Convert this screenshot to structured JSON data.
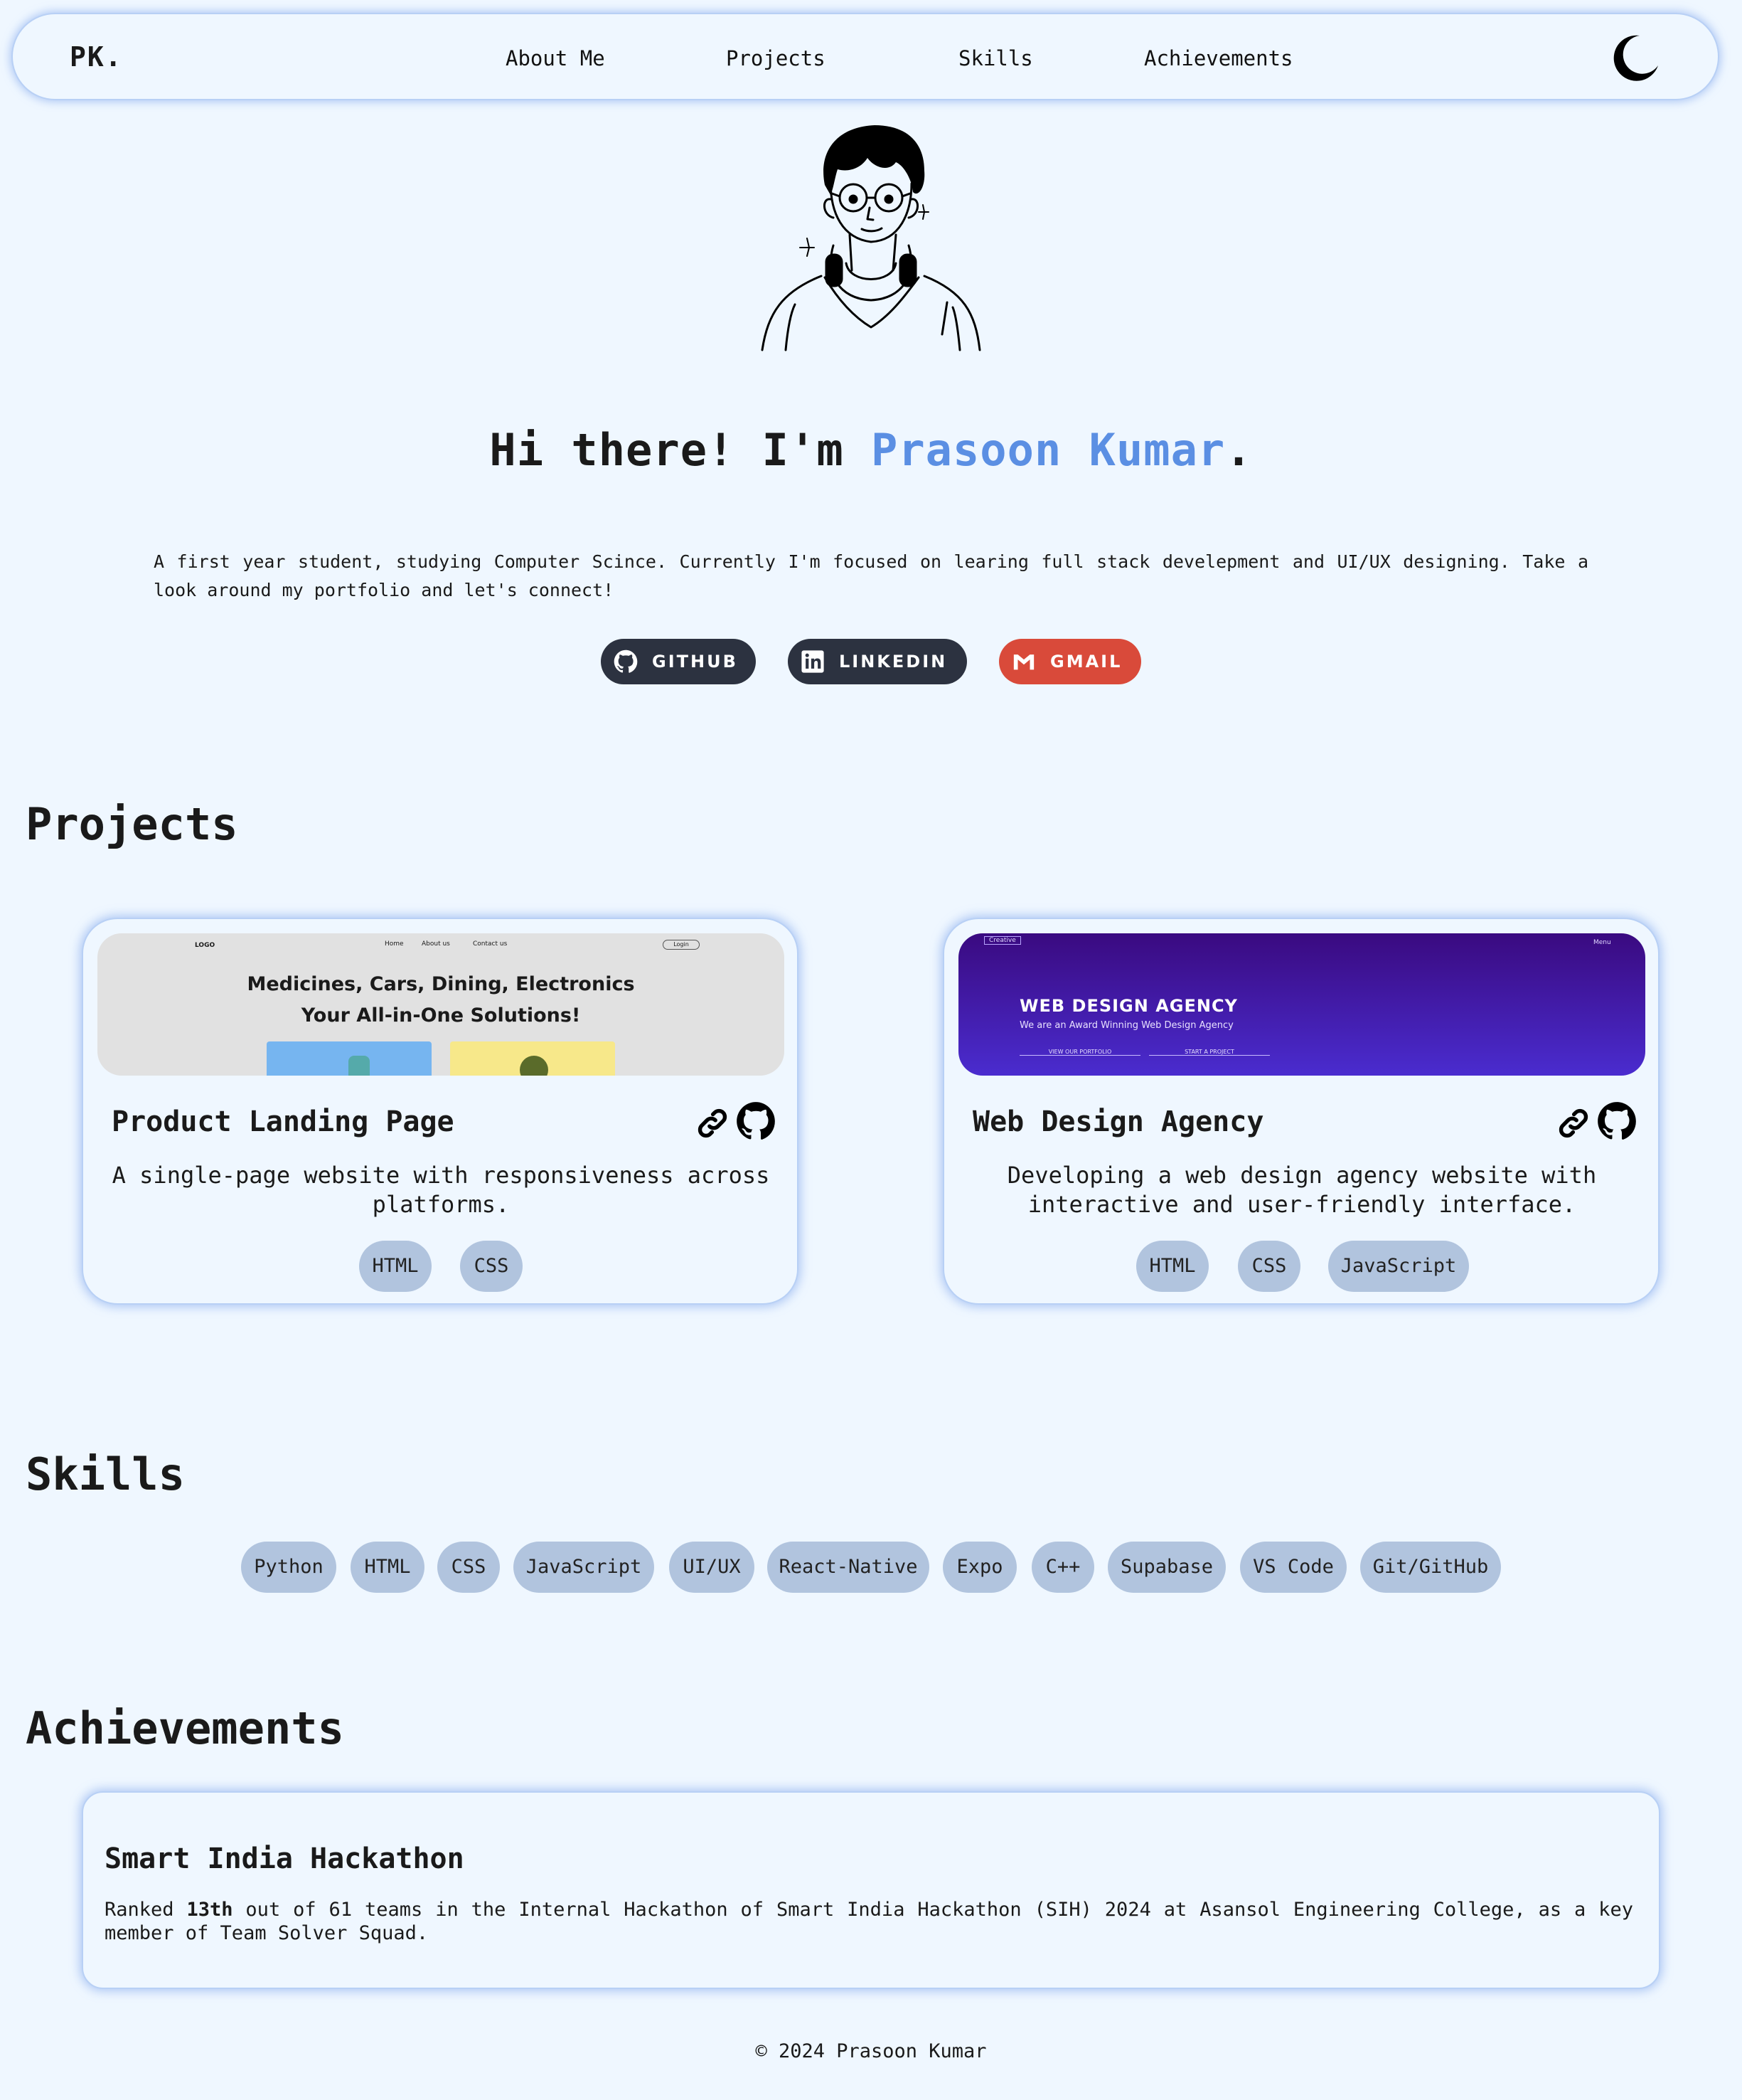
{
  "nav": {
    "logo": "PK.",
    "links": [
      "About Me",
      "Projects",
      "Skills",
      "Achievements"
    ],
    "theme_icon": "moon-icon"
  },
  "hero": {
    "greeting": "Hi there! I'm ",
    "name": "Prasoon Kumar",
    "period": ".",
    "description": "A first year student, studying Computer Scince. Currently I'm focused on learing full stack develepment and UI/UX designing. Take a look around my portfolio and let's connect!",
    "buttons": [
      {
        "label": "GITHUB",
        "icon": "github-icon"
      },
      {
        "label": "LINKEDIN",
        "icon": "linkedin-icon"
      },
      {
        "label": "GMAIL",
        "icon": "gmail-icon"
      }
    ],
    "avatar_icon": "avatar-illustration"
  },
  "projects": {
    "heading": "Projects",
    "items": [
      {
        "title": "Product Landing Page",
        "description": "A single-page website with responsiveness across platforms.",
        "tags": [
          "HTML",
          "CSS"
        ],
        "thumb": {
          "logo": "LOGO",
          "nav": [
            "Home",
            "About us",
            "Contact us"
          ],
          "login": "Login",
          "line1": "Medicines, Cars, Dining, Electronics",
          "line2": "Your All-in-One Solutions!"
        }
      },
      {
        "title": "Web Design Agency",
        "description": "Developing a web design agency website with interactive and user-friendly interface.",
        "tags": [
          "HTML",
          "CSS",
          "JavaScript"
        ],
        "thumb": {
          "badge": "Creative",
          "menu": "Menu",
          "headline": "WEB DESIGN AGENCY",
          "sub": "We are an Award Winning Web Design Agency",
          "btn1": "VIEW OUR PORTFOLIO",
          "btn2": "START A PROJECT"
        }
      }
    ]
  },
  "skills": {
    "heading": "Skills",
    "items": [
      "Python",
      "HTML",
      "CSS",
      "JavaScript",
      "UI/UX",
      "React-Native",
      "Expo",
      "C++",
      "Supabase",
      "VS Code",
      "Git/GitHub"
    ]
  },
  "achievements": {
    "heading": "Achievements",
    "items": [
      {
        "title": "Smart India Hackathon",
        "text_before": "Ranked ",
        "text_bold": "13th",
        "text_after": " out of 61 teams in the Internal Hackathon of Smart India Hackathon (SIH) 2024 at Asansol Engineering College, as a key member of Team Solver Squad."
      }
    ]
  },
  "footer": {
    "text": "© 2024 Prasoon Kumar"
  },
  "colors": {
    "background": "#eff7ff",
    "accent": "#5b8fe3",
    "dark_button": "#2c3240",
    "gmail_button": "#d94a3a",
    "tag": "#b1c4de"
  }
}
